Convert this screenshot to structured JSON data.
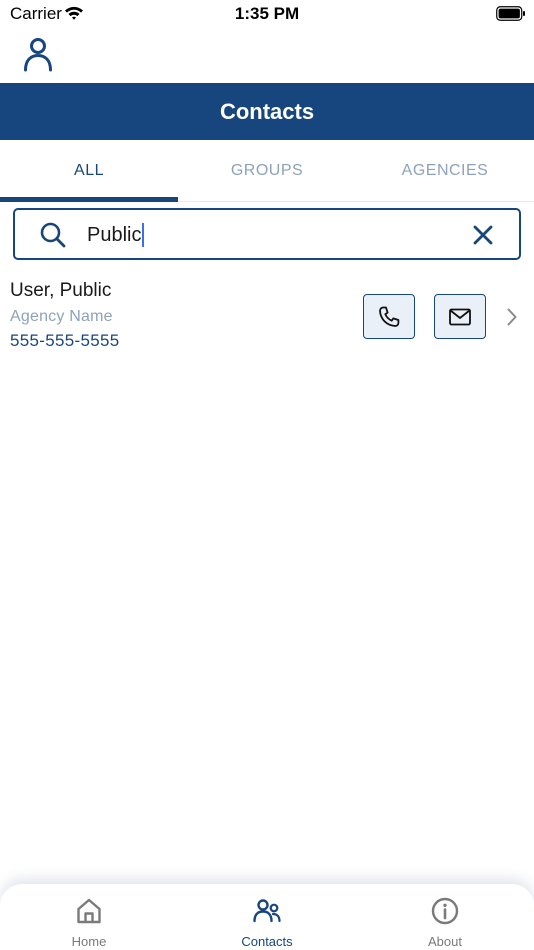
{
  "status_bar": {
    "carrier": "Carrier",
    "time": "1:35 PM"
  },
  "header": {
    "title": "Contacts",
    "profile_icon": "person-icon"
  },
  "tabs": [
    {
      "label": "ALL",
      "active": true
    },
    {
      "label": "GROUPS",
      "active": false
    },
    {
      "label": "AGENCIES",
      "active": false
    }
  ],
  "search": {
    "value": "Public",
    "search_icon": "search-icon",
    "clear_icon": "close-icon"
  },
  "contacts": [
    {
      "name": "User, Public",
      "agency": "Agency Name",
      "phone": "555-555-5555",
      "call_icon": "phone-icon",
      "email_icon": "mail-icon",
      "chevron_icon": "chevron-right-icon"
    }
  ],
  "bottom_nav": [
    {
      "label": "Home",
      "icon": "home-icon",
      "active": false
    },
    {
      "label": "Contacts",
      "icon": "people-icon",
      "active": true
    },
    {
      "label": "About",
      "icon": "info-icon",
      "active": false
    }
  ],
  "colors": {
    "primary": "#17467f",
    "inactive_tab": "#8da2bb",
    "button_fill": "#eaf0f8",
    "nav_inactive": "#7a7a7a",
    "caret": "#3b6ef0"
  }
}
